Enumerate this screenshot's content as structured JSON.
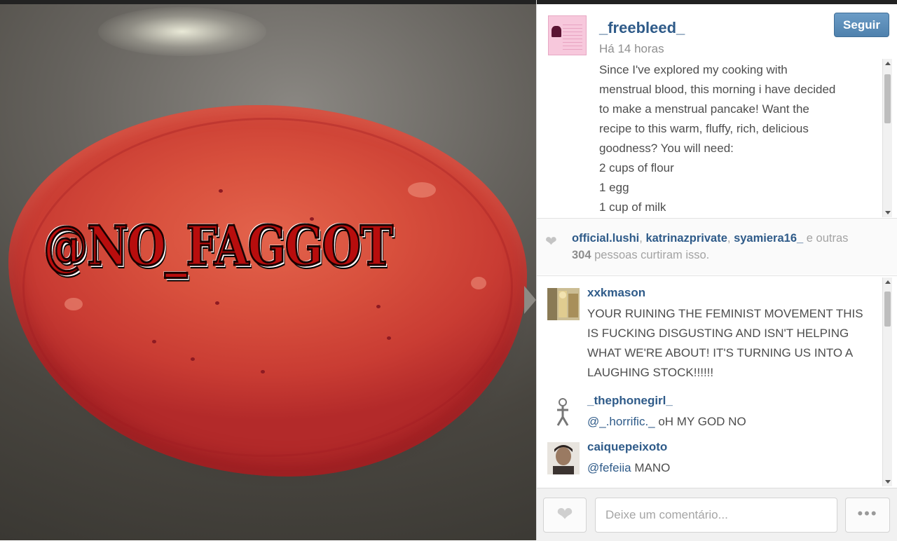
{
  "watermark": "@NO_FAGGOT",
  "post": {
    "username": "_freebleed_",
    "follow_label": "Seguir",
    "time_ago": "Há 14 horas",
    "caption_lines": [
      "Since I've explored my cooking with",
      "menstrual blood, this morning i have decided",
      "to make a menstrual pancake! Want the",
      "recipe to this warm, fluffy, rich, delicious",
      "goodness? You will need:",
      "2 cups of flour",
      "1 egg",
      "1 cup of milk"
    ]
  },
  "likes": {
    "users": [
      "official.lushi",
      "katrinazprivate",
      "syamiera16_"
    ],
    "sep": ", ",
    "and_others": " e outras",
    "count": "304",
    "suffix": " pessoas curtiram isso."
  },
  "comments": [
    {
      "username": "xxkmason",
      "text": "YOUR RUINING THE FEMINIST MOVEMENT THIS IS FUCKING DISGUSTING AND ISN'T HELPING WHAT WE'RE ABOUT! IT'S TURNING US INTO A LAUGHING STOCK!!!!!!"
    },
    {
      "username": "_thephonegirl_",
      "mention": "@_.horrific._",
      "text": " oH MY GOD NO"
    },
    {
      "username": "caiquepeixoto",
      "mention": "@fefeiia",
      "text": " MANO"
    }
  ],
  "comment_box": {
    "placeholder": "Deixe um comentário..."
  },
  "icons": {
    "heart": "heart-icon",
    "more": "more-options-icon"
  },
  "colors": {
    "link_blue": "#2f5b89",
    "follow_button": "#5a8bb7"
  }
}
